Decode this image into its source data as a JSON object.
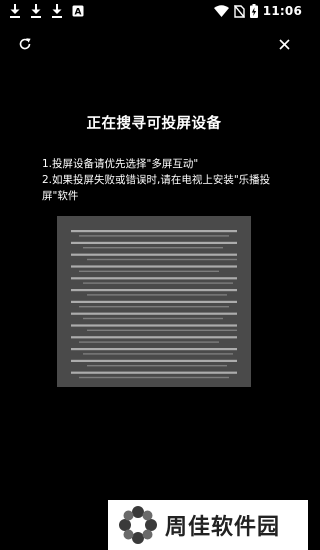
{
  "status_bar": {
    "time": "11:06",
    "left_icons": [
      "download-icon",
      "download-icon",
      "download-icon",
      "font-app-icon"
    ],
    "right_icons": [
      "wifi-icon",
      "no-sim-icon",
      "battery-charging-icon"
    ]
  },
  "toolbar": {
    "refresh_icon": "refresh-icon",
    "close_icon": "close-icon"
  },
  "title": "正在搜寻可投屏设备",
  "instructions": {
    "line1": "1.投屏设备请优先选择\"多屏互动\"",
    "line2": "2.如果投屏失败或错误时,请在电视上安装\"乐播投屏\"软件"
  },
  "scanner": {
    "background_color": "#4a4a4a",
    "line_color": "#bdbdbd",
    "line_count": 13
  },
  "watermark": {
    "text": "周佳软件园",
    "logo_icon": "flower-logo-icon"
  }
}
